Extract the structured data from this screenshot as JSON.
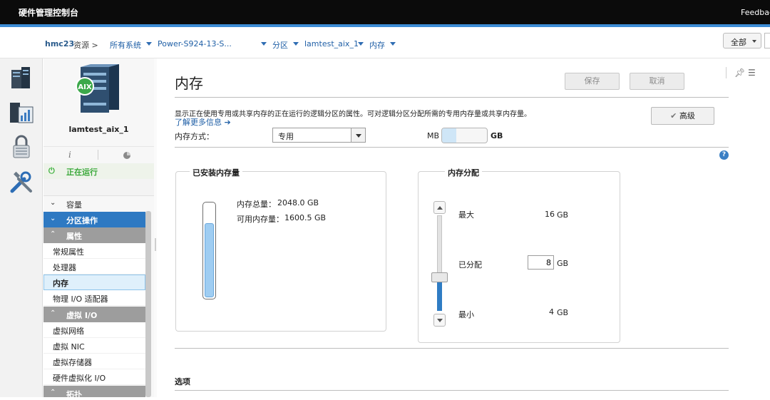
{
  "app": {
    "title": "硬件管理控制台",
    "feedback": "Feedback"
  },
  "breadcrumb": {
    "host": "hmc23",
    "resources": "资源 >",
    "all_systems": "所有系统",
    "server": "Power-S924-13-S...",
    "partitions": "分区",
    "lpar": "lamtest_aix_1",
    "memory": "内存"
  },
  "filter": {
    "label": "全部"
  },
  "partition": {
    "name": "lamtest_aix_1",
    "badge": "AIX",
    "info_icon": "i",
    "status": "正在运行"
  },
  "sidebar": {
    "capacity": "容量",
    "partition_actions": "分区操作",
    "properties": "属性",
    "property_items": [
      "常规属性",
      "处理器",
      "内存",
      "物理 I/O 适配器"
    ],
    "virtual_io": "虚拟 I/O",
    "virtual_items": [
      "虚拟网络",
      "虚拟 NIC",
      "虚拟存储器",
      "硬件虚拟化 I/O"
    ],
    "topology": "拓扑"
  },
  "main": {
    "title": "内存",
    "save": "保存",
    "cancel": "取消",
    "description": "显示正在使用专用或共享内存的正在运行的逻辑分区的属性。可对逻辑分区分配所需的专用内存量或共享内存量。",
    "learn_more": "了解更多信息 ➔",
    "advanced": "高级",
    "memory_mode_label": "内存方式：",
    "memory_mode_value": "专用",
    "unit_mb": "MB",
    "unit_gb": "GB",
    "options_title": "选项"
  },
  "installed": {
    "title": "已安装内存量",
    "total_label": "内存总量：",
    "total_value": "2048.0 GB",
    "available_label": "可用内存量：",
    "available_value": "1600.5 GB",
    "available_fraction": 0.78
  },
  "allocation": {
    "title": "内存分配",
    "max_label": "最大",
    "max_value": "16",
    "assigned_label": "已分配",
    "assigned_value": "8",
    "min_label": "最小",
    "min_value": "4",
    "unit": "GB"
  },
  "colors": {
    "accent": "#3d8cd5",
    "running": "#3aa83a",
    "selected_nav": "#2e79c2"
  }
}
